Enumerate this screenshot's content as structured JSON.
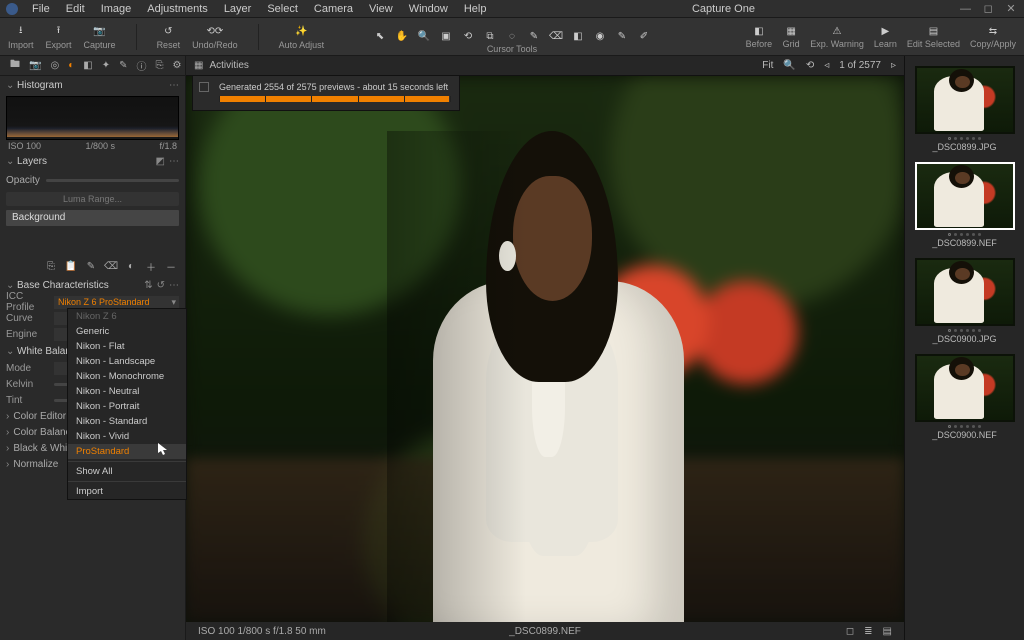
{
  "app": {
    "title": "Capture One"
  },
  "menubar": [
    "File",
    "Edit",
    "Image",
    "Adjustments",
    "Layer",
    "Select",
    "Camera",
    "View",
    "Window",
    "Help"
  ],
  "toolbar_left": [
    {
      "name": "import",
      "label": "Import"
    },
    {
      "name": "export",
      "label": "Export"
    },
    {
      "name": "capture",
      "label": "Capture"
    },
    {
      "name": "reset",
      "label": "Reset"
    },
    {
      "name": "undoredo",
      "label": "Undo/Redo"
    },
    {
      "name": "autoadjust",
      "label": "Auto Adjust"
    }
  ],
  "cursor_tools_label": "Cursor Tools",
  "toolbar_right": [
    {
      "name": "before",
      "label": "Before"
    },
    {
      "name": "grid",
      "label": "Grid"
    },
    {
      "name": "expwarn",
      "label": "Exp. Warning"
    },
    {
      "name": "learn",
      "label": "Learn"
    },
    {
      "name": "editsel",
      "label": "Edit Selected"
    },
    {
      "name": "copyapply",
      "label": "Copy/Apply"
    }
  ],
  "progress": {
    "text": "Generated 2554 of 2575 previews - about 15 seconds left",
    "percent": 99
  },
  "viewer_top": {
    "activities": "Activities",
    "counter": "1 of 2577"
  },
  "histogram": {
    "title": "Histogram",
    "iso": "ISO 100",
    "shutter": "1/800 s",
    "aperture": "f/1.8"
  },
  "layers": {
    "title": "Layers",
    "opacity_label": "Opacity",
    "luma": "Luma Range...",
    "background": "Background"
  },
  "base": {
    "title": "Base Characteristics",
    "icc_label": "ICC Profile",
    "icc_value": "Nikon Z 6 ProStandard",
    "curve_label": "Curve",
    "engine_label": "Engine"
  },
  "icc_menu": {
    "header": "Nikon Z 6",
    "items": [
      "Generic",
      "Nikon - Flat",
      "Nikon - Landscape",
      "Nikon - Monochrome",
      "Nikon - Neutral",
      "Nikon - Portrait",
      "Nikon - Standard",
      "Nikon - Vivid",
      "ProStandard"
    ],
    "footer": [
      "Show All",
      "Import"
    ]
  },
  "wb": {
    "title": "White Balance",
    "mode": "Mode",
    "kelvin": "Kelvin",
    "tint": "Tint"
  },
  "collapsed": [
    "Color Editor",
    "Color Balance",
    "Black & White",
    "Normalize"
  ],
  "viewer_bottom": {
    "left": "ISO 100    1/800 s   f/1.8    50 mm",
    "file": "_DSC0899.NEF"
  },
  "thumbs": [
    {
      "file": "_DSC0899.JPG",
      "selected": false
    },
    {
      "file": "_DSC0899.NEF",
      "selected": true
    },
    {
      "file": "_DSC0900.JPG",
      "selected": false
    },
    {
      "file": "_DSC0900.NEF",
      "selected": false
    }
  ]
}
